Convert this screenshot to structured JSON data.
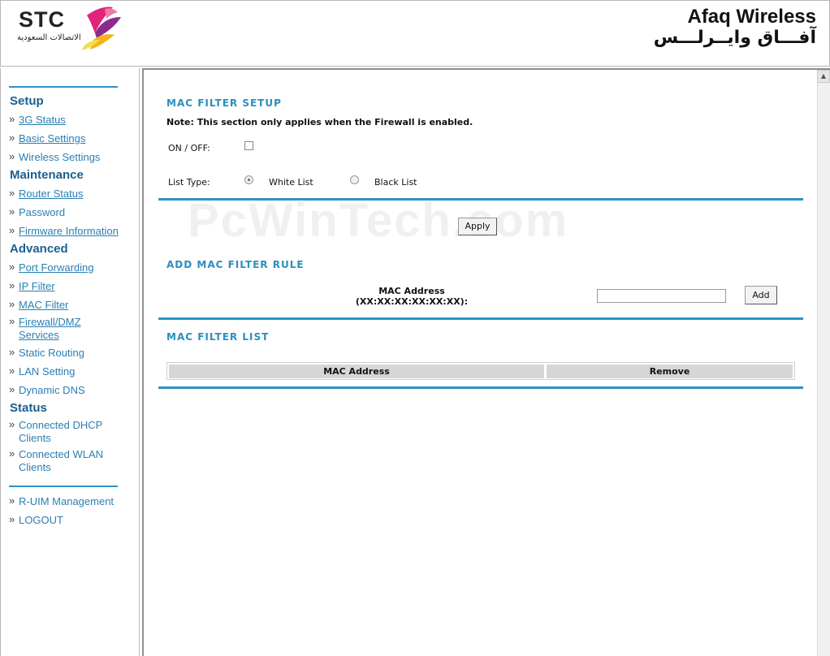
{
  "header": {
    "logo_text": "STC",
    "logo_arabic": "الاتصالات السعودية",
    "brand_en": "Afaq Wireless",
    "brand_ar": "آفـــاق وايــرلـــس"
  },
  "sidebar": {
    "sections": {
      "setup": "Setup",
      "maintenance": "Maintenance",
      "advanced": "Advanced",
      "status": "Status"
    },
    "items": [
      {
        "label": "3G Status"
      },
      {
        "label": "Basic Settings"
      },
      {
        "label": "Wireless Settings"
      },
      {
        "label": "Router Status"
      },
      {
        "label": "Password"
      },
      {
        "label": "Firmware Information"
      },
      {
        "label": "Port Forwarding"
      },
      {
        "label": "IP Filter"
      },
      {
        "label": "MAC Filter"
      },
      {
        "label": "Firewall/DMZ Services"
      },
      {
        "label": "Static Routing"
      },
      {
        "label": "LAN Setting"
      },
      {
        "label": "Dynamic DNS"
      },
      {
        "label": "Connected DHCP Clients"
      },
      {
        "label": "Connected WLAN Clients"
      },
      {
        "label": "R-UIM Management"
      },
      {
        "label": "LOGOUT"
      }
    ],
    "bullet": "»"
  },
  "main": {
    "setup_title": "MAC FILTER SETUP",
    "note": "Note: This section only applies when the Firewall is enabled.",
    "on_off_label": "ON / OFF:",
    "on_off_checked": false,
    "list_type_label": "List Type:",
    "white_list_label": "White List",
    "black_list_label": "Black List",
    "list_type_selected": "White List",
    "apply_label": "Apply",
    "add_rule_title": "ADD MAC FILTER RULE",
    "mac_address_label": "MAC Address",
    "mac_format_label": "(XX:XX:XX:XX:XX:XX):",
    "mac_input_value": "",
    "add_label": "Add",
    "list_title": "MAC FILTER LIST",
    "table_headers": [
      "MAC Address",
      "Remove"
    ]
  },
  "watermark": "PcWinTech.com",
  "colors": {
    "accent": "#2b93c4",
    "section_heading": "#1d5f8e",
    "link": "#2a7fb3"
  }
}
